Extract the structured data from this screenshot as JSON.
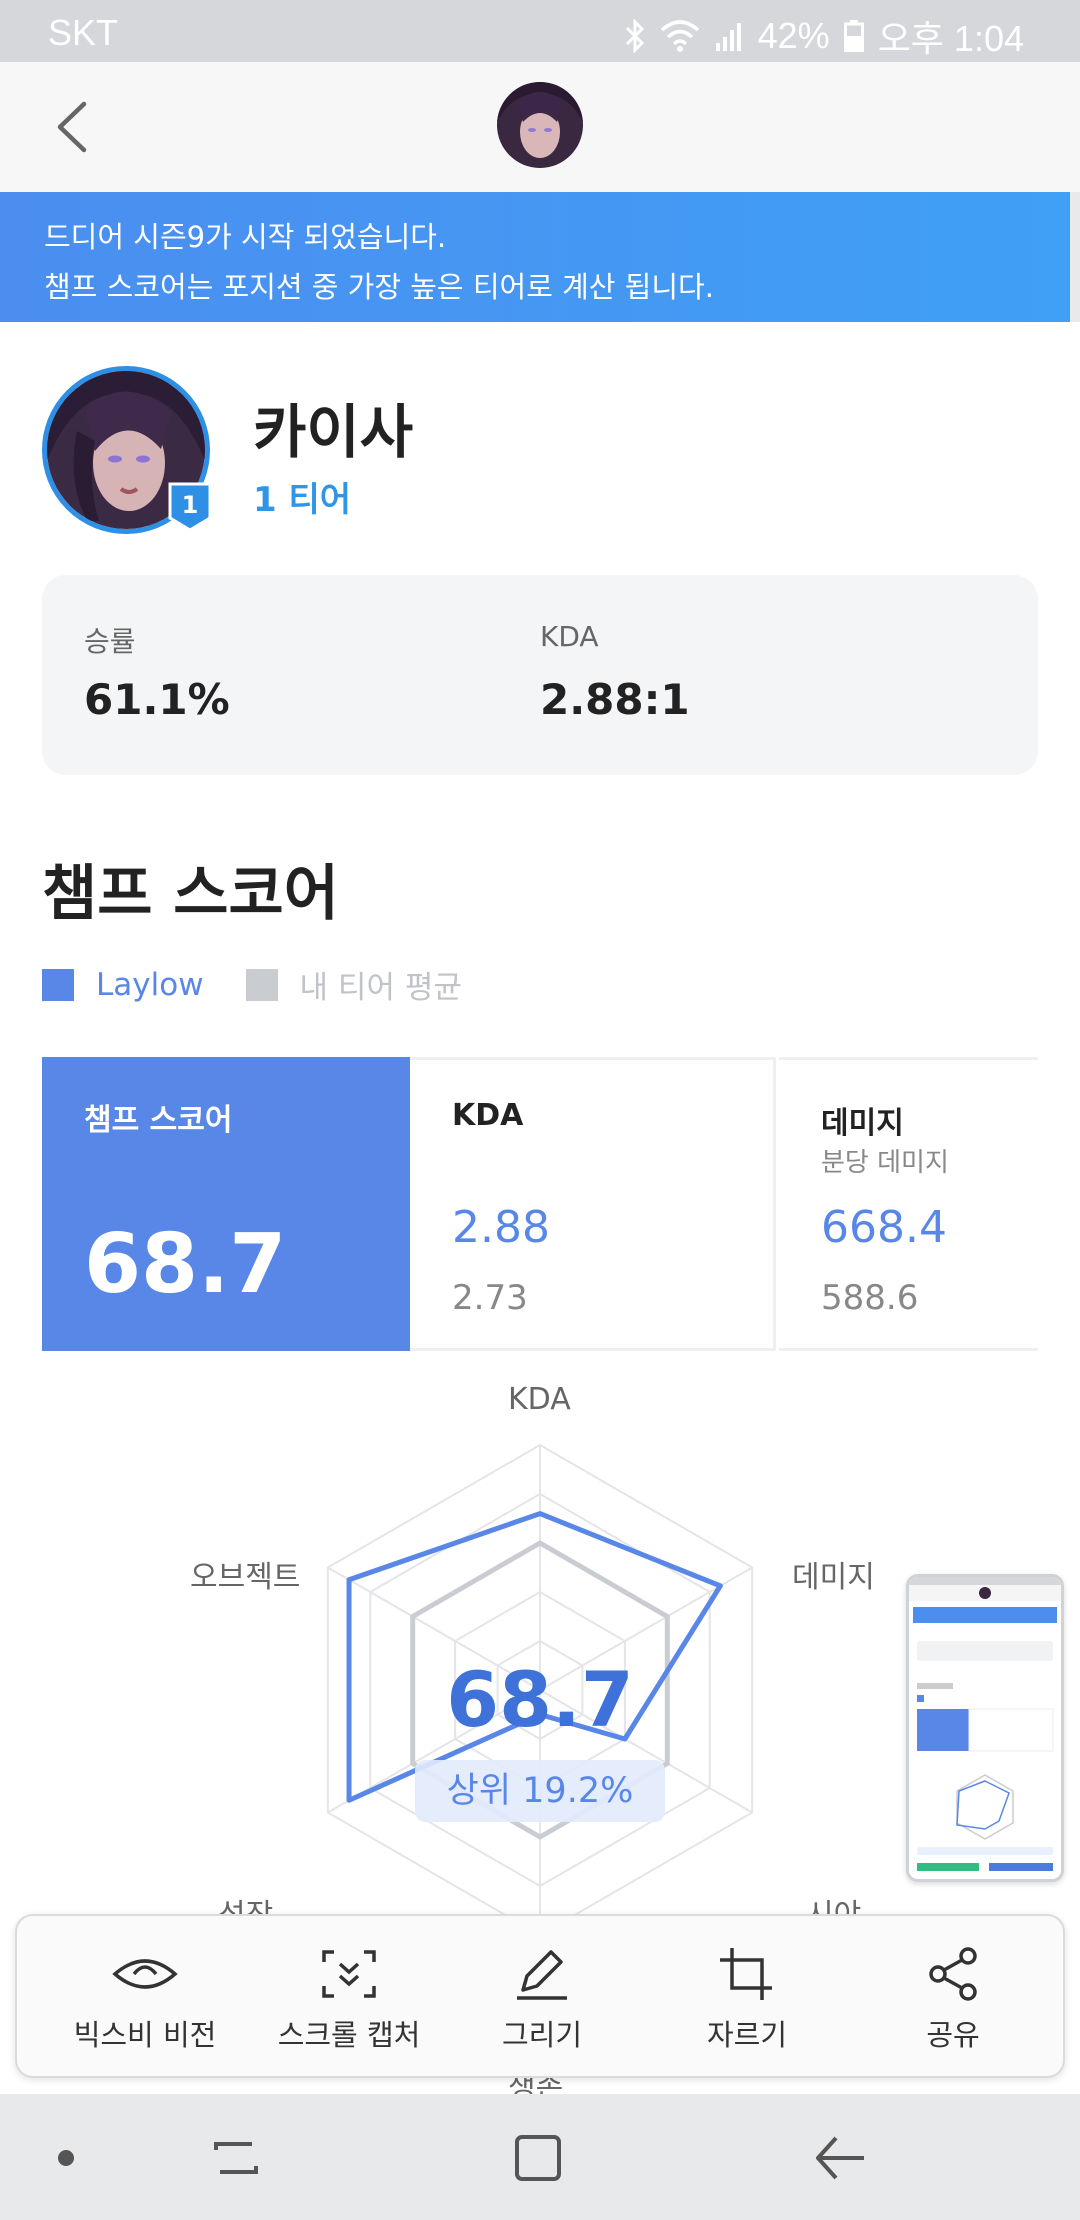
{
  "status_bar": {
    "carrier": "SKT",
    "battery": "42%",
    "time": "오후 1:04"
  },
  "banner": {
    "line1": "드디어 시즌9가 시작 되었습니다.",
    "line2": "챔프 스코어는 포지션 중 가장 높은 티어로 계산 됩니다."
  },
  "champion": {
    "name": "카이사",
    "tier": "1 티어",
    "badge": "1"
  },
  "stats": {
    "winrate_label": "승률",
    "winrate_value": "61.1%",
    "kda_label": "KDA",
    "kda_value": "2.88:1"
  },
  "section": {
    "title": "챔프 스코어"
  },
  "legend": [
    {
      "label": "Laylow",
      "color": "#5887e8"
    },
    {
      "label": "내 티어 평균",
      "color": "#c9ccd1"
    }
  ],
  "score_cards": {
    "main": {
      "title": "챔프 스코어",
      "value": "68.7"
    },
    "kda": {
      "title": "KDA",
      "player": "2.88",
      "average": "2.73"
    },
    "damage": {
      "title": "데미지",
      "subtitle": "분당 데미지",
      "player": "668.4",
      "average": "588.6"
    }
  },
  "radar": {
    "axes": [
      "KDA",
      "데미지",
      "시야",
      "생존",
      "성장",
      "오브젝트"
    ],
    "player": [
      0.72,
      0.85,
      0.4,
      0.1,
      0.9,
      0.9
    ],
    "average": [
      0.6,
      0.6,
      0.6,
      0.6,
      0.6,
      0.6
    ],
    "score": "68.7",
    "rank": "상위 19.2%"
  },
  "toolbar": {
    "bixby_vision": "빅스비 비전",
    "scroll_capture": "스크롤 캡처",
    "draw": "그리기",
    "crop": "자르기",
    "share": "공유"
  }
}
